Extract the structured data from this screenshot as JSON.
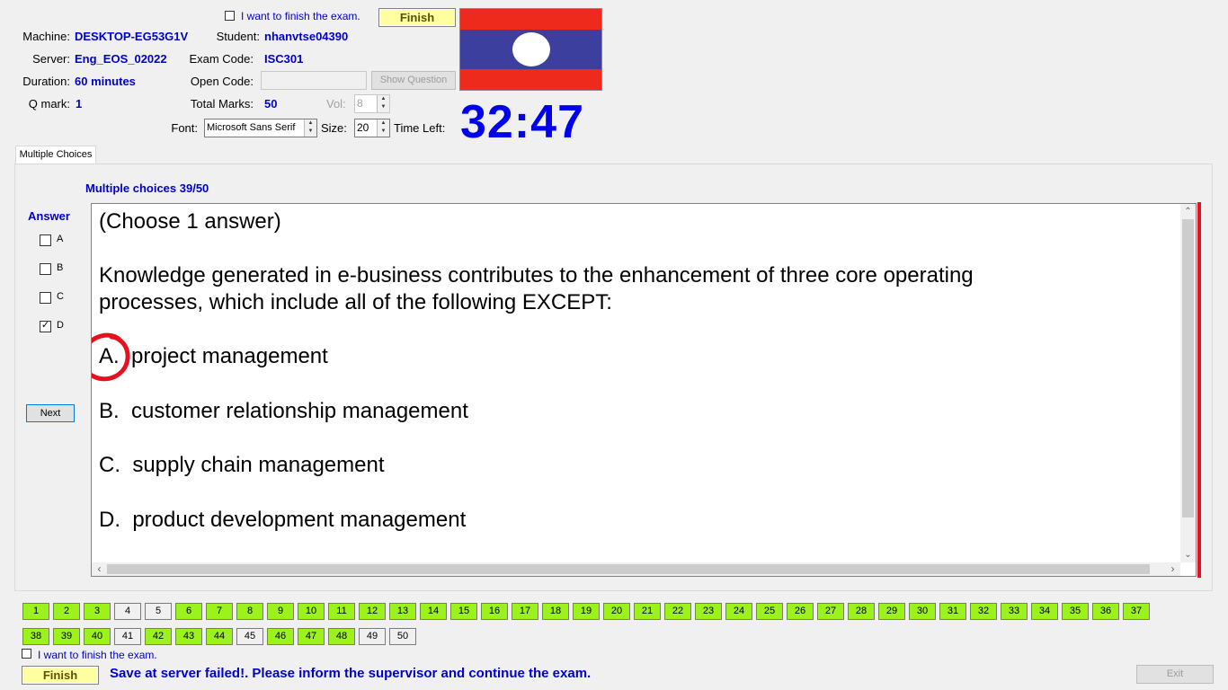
{
  "header": {
    "finish_checkbox_label": "I want to finish the exam.",
    "finish_button": "Finish",
    "machine_label": "Machine:",
    "machine_value": "DESKTOP-EG53G1V",
    "student_label": "Student:",
    "student_value": "nhanvtse04390",
    "server_label": "Server:",
    "server_value": "Eng_EOS_02022",
    "exam_code_label": "Exam Code:",
    "exam_code_value": "ISC301",
    "duration_label": "Duration:",
    "duration_value": "60 minutes",
    "open_code_label": "Open Code:",
    "open_code_value": "",
    "show_question_button": "Show Question",
    "qmark_label": "Q mark:",
    "qmark_value": "1",
    "total_marks_label": "Total Marks:",
    "total_marks_value": "50",
    "vol_label": "Vol:",
    "vol_value": "8",
    "font_label": "Font:",
    "font_value": "Microsoft Sans Serif",
    "size_label": "Size:",
    "size_value": "20",
    "time_left_label": "Time Left:",
    "time_left_value": "32:47",
    "flag_colors": {
      "red": "#ee2a1c",
      "blue": "#3d3f9f",
      "white": "#ffffff"
    }
  },
  "tab": {
    "label": "Multiple Choices"
  },
  "question": {
    "counter": "Multiple choices 39/50",
    "answer_label": "Answer",
    "options": [
      {
        "key": "A",
        "checked": false
      },
      {
        "key": "B",
        "checked": false
      },
      {
        "key": "C",
        "checked": false
      },
      {
        "key": "D",
        "checked": true
      }
    ],
    "next_button": "Next",
    "instruction": "(Choose 1 answer)",
    "stem_line1": "Knowledge generated in e-business contributes to the enhancement of three core operating",
    "stem_line2": "processes, which include all of the following EXCEPT:",
    "choice_a": "A.  project management",
    "choice_b": "B.  customer relationship management",
    "choice_c": "C.  supply chain management",
    "choice_d": "D.  product development management"
  },
  "navigator": {
    "row1": [
      "1",
      "2",
      "3",
      "4",
      "5",
      "6",
      "7",
      "8",
      "9",
      "10",
      "11",
      "12",
      "13",
      "14",
      "15",
      "16",
      "17",
      "18",
      "19",
      "20",
      "21",
      "22",
      "23",
      "24",
      "25",
      "26",
      "27",
      "28",
      "29",
      "30",
      "31",
      "32",
      "33",
      "34",
      "35",
      "36",
      "37"
    ],
    "row2": [
      "38",
      "39",
      "40",
      "41",
      "42",
      "43",
      "44",
      "45",
      "46",
      "47",
      "48",
      "49",
      "50"
    ],
    "unanswered": [
      "4",
      "5",
      "41",
      "45",
      "49",
      "50"
    ],
    "answered_color": "#9cf21b"
  },
  "footer": {
    "finish_checkbox_label": "I want to finish the exam.",
    "finish_button": "Finish",
    "status_message": "Save at server failed!. Please inform the supervisor and continue the exam.",
    "exit_button": "Exit"
  }
}
